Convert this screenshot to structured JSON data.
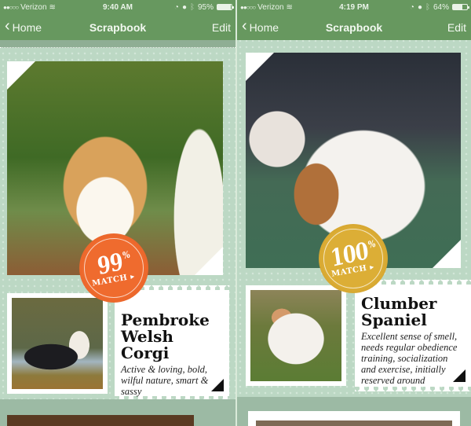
{
  "screens": [
    {
      "status": {
        "carrier": "Verizon",
        "signal_dots": "●●○○○",
        "time": "9:40 AM",
        "battery": "95%",
        "battery_level": 0.95
      },
      "nav": {
        "back_label": "Home",
        "title": "Scrapbook",
        "edit_label": "Edit"
      },
      "card": {
        "match_value": "99",
        "match_percent": "%",
        "match_label": "MATCH",
        "badge_color": "#e8612c",
        "breed": "Pembroke Welsh Corgi",
        "description": "Active & loving, bold, wilful nature, smart & sassy"
      }
    },
    {
      "status": {
        "carrier": "Verizon",
        "signal_dots": "●●○○○",
        "time": "4:19 PM",
        "battery": "64%",
        "battery_level": 0.64
      },
      "nav": {
        "back_label": "Home",
        "title": "Scrapbook",
        "edit_label": "Edit"
      },
      "card": {
        "match_value": "100",
        "match_percent": "%",
        "match_label": "MATCH",
        "badge_color": "#d4a22a",
        "breed": "Clumber Spaniel",
        "description": "Excellent sense of smell, needs regular obedience training, socialization and exercise, initially reserved around"
      }
    }
  ],
  "icons": {
    "wifi": "wifi-icon",
    "lock": "orientation-lock-icon",
    "alarm": "alarm-icon",
    "bluetooth": "bluetooth-icon",
    "back": "chevron-left-icon"
  },
  "glyphs": {
    "chevron": "‹",
    "wifi": "≋",
    "lock": "◔",
    "alarm": "●",
    "bluetooth": "ᛒ",
    "play": "▸"
  }
}
